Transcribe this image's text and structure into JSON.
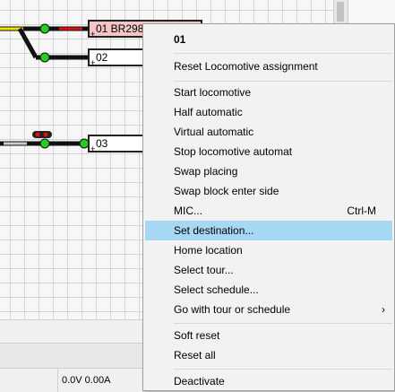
{
  "track_plan": {
    "blocks": [
      {
        "id": "block-01",
        "label": "01 BR298",
        "state": "occupied"
      },
      {
        "id": "block-02",
        "label": "02",
        "state": "free"
      },
      {
        "id": "block-03",
        "label": "03",
        "state": "free"
      }
    ],
    "block_plus": "+"
  },
  "status_bar": {
    "voltage_current": "0.0V 0.00A"
  },
  "context_menu": {
    "header": "01",
    "items": [
      {
        "label": "Reset Locomotive assignment"
      },
      {
        "label": "Start locomotive"
      },
      {
        "label": "Half automatic"
      },
      {
        "label": "Virtual automatic"
      },
      {
        "label": "Stop locomotive automat"
      },
      {
        "label": "Swap placing"
      },
      {
        "label": "Swap block enter side"
      },
      {
        "label": "MIC...",
        "shortcut": "Ctrl-M"
      },
      {
        "label": "Set destination...",
        "highlighted": true
      },
      {
        "label": "Home location"
      },
      {
        "label": "Select tour..."
      },
      {
        "label": "Select schedule..."
      },
      {
        "label": "Go with tour or schedule",
        "submenu_arrow": "›"
      },
      {
        "label": "Soft reset"
      },
      {
        "label": "Reset all"
      },
      {
        "label": "Deactivate"
      }
    ]
  },
  "colors": {
    "highlight": "#a6d8f3",
    "occupied_block": "#f4c5c5",
    "signal_green": "#22cc22",
    "signal_red": "#dd1111",
    "track_yellow": "#f2e400"
  }
}
